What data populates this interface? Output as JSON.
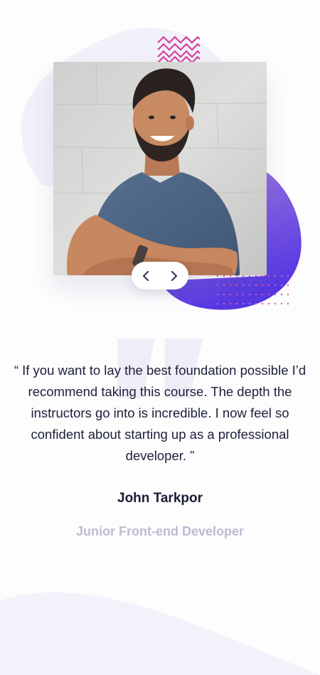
{
  "testimonial": {
    "quote": "“ If you want to lay the best foundation possible I’d recommend taking this course. The depth the instructors go into is incredible. I now feel so confident about starting up as a professional developer. ”",
    "author_name": "John Tarkpor",
    "author_role": "Junior Front-end Developer"
  },
  "slider": {
    "prev_icon": "chevron-left-icon",
    "next_icon": "chevron-right-icon"
  },
  "colors": {
    "page_background": "#fdfdfe",
    "blob_light": "#f1f1fa",
    "blob_purple_start": "#8b6ee0",
    "blob_purple_end": "#5b3fe0",
    "zigzag_pink": "#d6409a",
    "dots_pink": "#d55fb5",
    "quote_mark": "#f0eff8",
    "text_dark": "#1b1d36",
    "text_muted": "#bdbbd2"
  }
}
